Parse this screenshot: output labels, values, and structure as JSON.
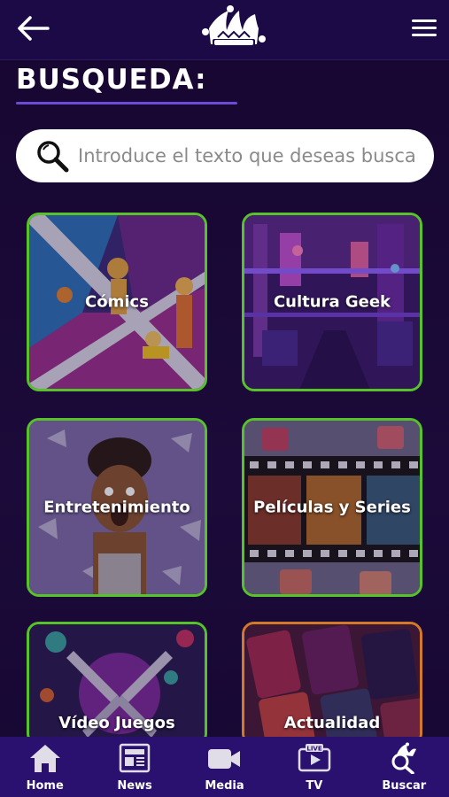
{
  "header": {
    "back_icon": "back-arrow-icon",
    "logo_icon": "jester-hat-logo",
    "menu_icon": "hamburger-menu-icon"
  },
  "page": {
    "title": "BUSQUEDA:"
  },
  "search": {
    "placeholder": "Introduce el texto que deseas buscar",
    "value": ""
  },
  "categories": [
    {
      "label": "Cómics"
    },
    {
      "label": "Cultura Geek"
    },
    {
      "label": "Entretenimiento"
    },
    {
      "label": "Películas y Series"
    },
    {
      "label": "Vídeo Juegos"
    },
    {
      "label": "Actualidad"
    }
  ],
  "bottom_nav": [
    {
      "label": "Home",
      "icon": "home-icon"
    },
    {
      "label": "News",
      "icon": "newspaper-icon"
    },
    {
      "label": "Media",
      "icon": "video-camera-icon"
    },
    {
      "label": "TV",
      "icon": "live-tv-icon"
    },
    {
      "label": "Buscar",
      "icon": "search-jester-icon"
    }
  ],
  "colors": {
    "background": "#1a0a33",
    "topbar": "#1c0a46",
    "accent_underline": "#6a4ad6",
    "card_border_green": "#58c22a",
    "card_border_orange": "#d07a2a",
    "bottom_nav": "#2a1170"
  }
}
